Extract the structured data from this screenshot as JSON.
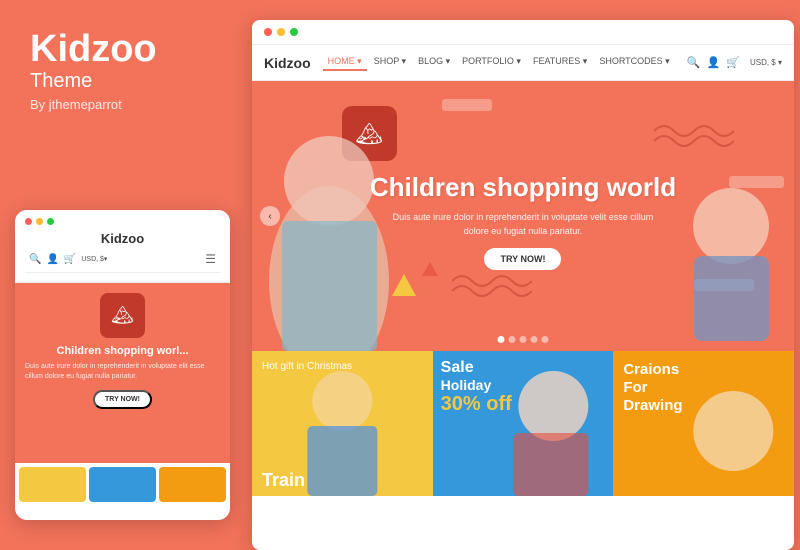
{
  "left": {
    "brand": "Kidzoo",
    "theme_label": "Theme",
    "by_label": "By jthemeparrot",
    "mobile_brand": "Kidzoo",
    "mobile_hero_title": "Children shopping worl...",
    "mobile_hero_desc": "Duis aute irure dolor in reprehenderit in voluptate elit esse cillum dolore eu fugiat nulla pariatur.",
    "mobile_cta": "TRY NOW!"
  },
  "desktop": {
    "nav_brand": "Kidzoo",
    "nav_items": [
      {
        "label": "HOME ▾",
        "active": true
      },
      {
        "label": "SHOP ▾",
        "active": false
      },
      {
        "label": "BLOG ▾",
        "active": false
      },
      {
        "label": "PORTFOLIO ▾",
        "active": false
      },
      {
        "label": "FEATURES ▾",
        "active": false
      },
      {
        "label": "SHORTCODES ▾",
        "active": false
      }
    ],
    "nav_currency": "USD, $ ▾",
    "hero_title": "Children shopping world",
    "hero_desc": "Duis aute irure dolor in reprehenderit in voluptate velit esse cillum dolore eu fugiat nulla pariatur.",
    "hero_cta": "TRY NOW!",
    "dots": [
      "active",
      "",
      "",
      "",
      ""
    ],
    "products": [
      {
        "id": "hot-gift",
        "bg": "#f5c842",
        "label_small": "Hot gift in Christmas",
        "label_big": "Train",
        "type": "yellow"
      },
      {
        "id": "sale-holiday",
        "bg": "#3498db",
        "sale_top": "Sale",
        "sale_middle": "Holiday",
        "sale_off": "30% off",
        "type": "blue"
      },
      {
        "id": "crayons",
        "bg": "#f39c12",
        "title": "Craions For Drawing",
        "type": "orange"
      }
    ]
  },
  "window_dots": {
    "red": "#ff5f56",
    "yellow": "#ffbd2e",
    "green": "#27c93f"
  },
  "colors": {
    "brand": "#f2725a",
    "nav_active": "#f2725a"
  }
}
